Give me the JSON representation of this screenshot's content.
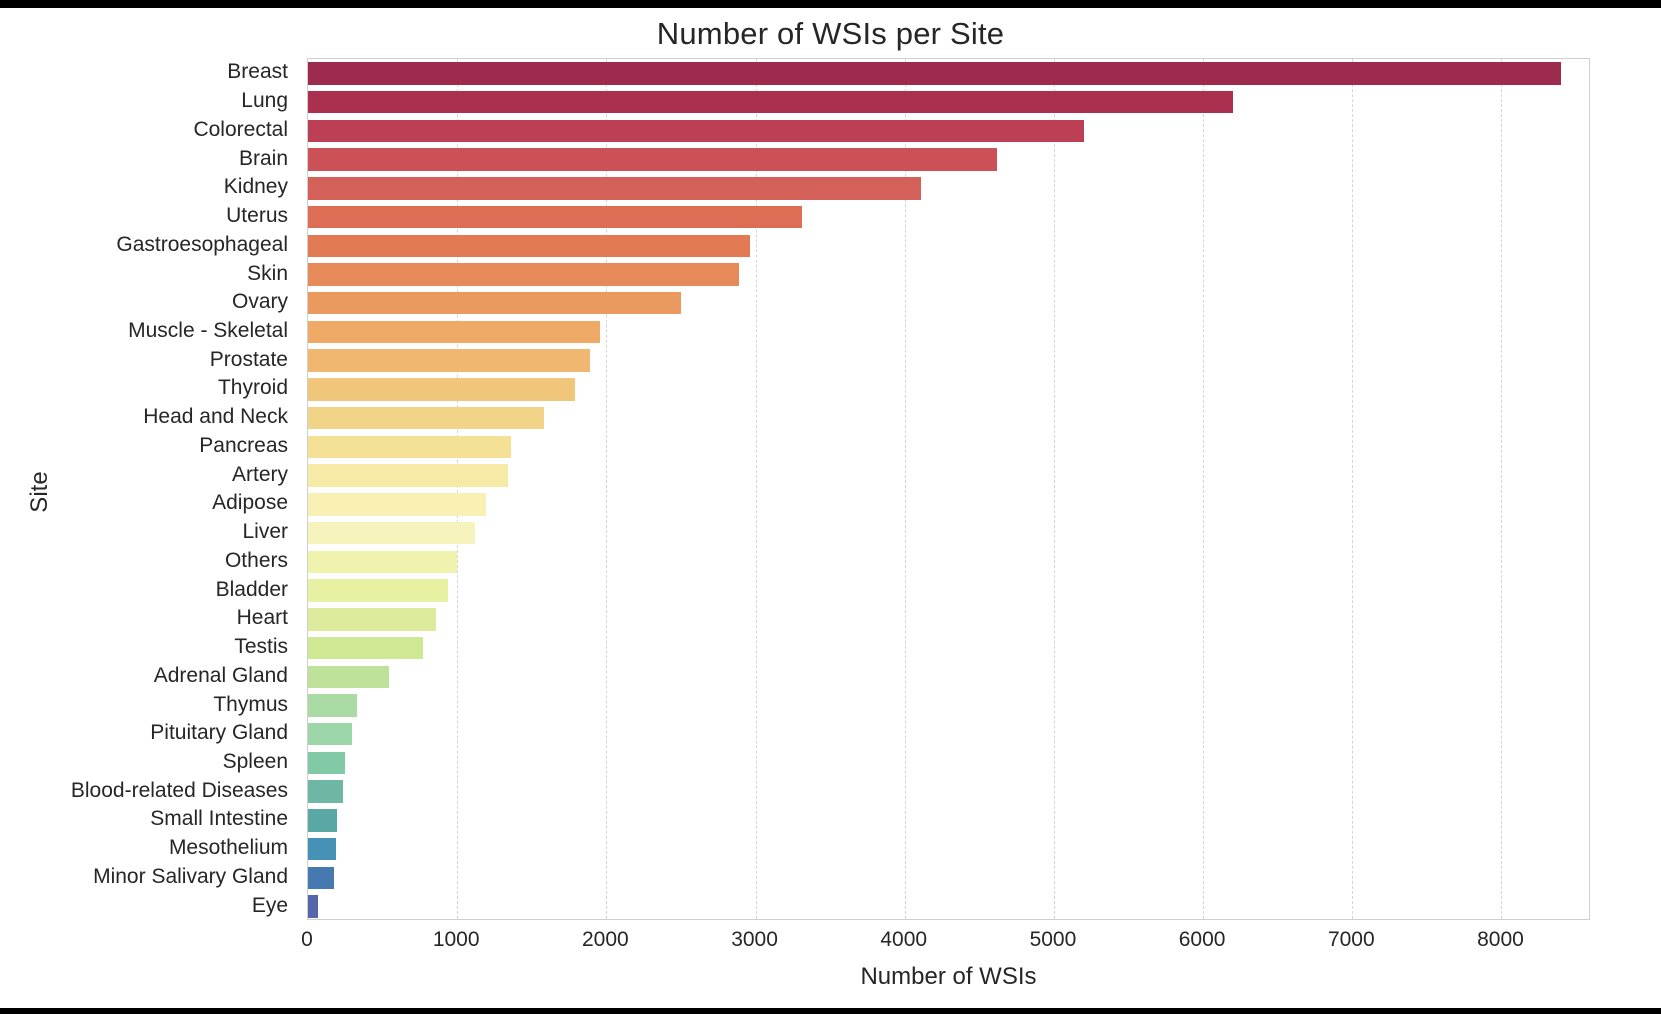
{
  "chart_data": {
    "type": "bar",
    "orientation": "horizontal",
    "title": "Number of WSIs per Site",
    "xlabel": "Number of WSIs",
    "ylabel": "Site",
    "grid": "vertical-dashed",
    "legend": "none",
    "xlim": [
      0,
      8600
    ],
    "xticks": [
      0,
      1000,
      2000,
      3000,
      4000,
      5000,
      6000,
      7000,
      8000
    ],
    "xtick_labels": [
      "0",
      "1000",
      "2000",
      "3000",
      "4000",
      "5000",
      "6000",
      "7000",
      "8000"
    ],
    "colormap": "Spectral reversed (crimson → orange → yellow → green → blue)",
    "categories": [
      "Breast",
      "Lung",
      "Colorectal",
      "Brain",
      "Kidney",
      "Uterus",
      "Gastroesophageal",
      "Skin",
      "Ovary",
      "Muscle - Skeletal",
      "Prostate",
      "Thyroid",
      "Head and Neck",
      "Pancreas",
      "Artery",
      "Adipose",
      "Liver",
      "Others",
      "Bladder",
      "Heart",
      "Testis",
      "Adrenal Gland",
      "Thymus",
      "Pituitary Gland",
      "Spleen",
      "Blood-related Diseases",
      "Small Intestine",
      "Mesothelium",
      "Minor Salivary Gland",
      "Eye"
    ],
    "values": [
      8400,
      6200,
      5200,
      4620,
      4110,
      3310,
      2960,
      2890,
      2500,
      1960,
      1890,
      1790,
      1580,
      1360,
      1340,
      1190,
      1120,
      1000,
      940,
      860,
      770,
      540,
      330,
      295,
      250,
      235,
      195,
      185,
      175,
      70
    ],
    "colors": [
      "#9e2a4d",
      "#ab2f4f",
      "#bc3f55",
      "#cb5157",
      "#d4605a",
      "#dd6d54",
      "#e27b54",
      "#e68a5a",
      "#eb9a5f",
      "#eeaa66",
      "#efb76f",
      "#f0c67b",
      "#f2d489",
      "#f5e196",
      "#f7eaa6",
      "#f9f0b5",
      "#f6f3bd",
      "#f0f3ae",
      "#e8f0a2",
      "#dcec9c",
      "#cfe894",
      "#bfe29a",
      "#abdba4",
      "#9dd6a8",
      "#82c9a5",
      "#6db7a4",
      "#5aa8a6",
      "#4691b6",
      "#4579b0",
      "#5566ab"
    ]
  },
  "figure": {
    "background": "#ffffff",
    "axes_border_color": "#cfcfcf",
    "grid_color": "#d4d4d4",
    "text_color": "#262626"
  }
}
